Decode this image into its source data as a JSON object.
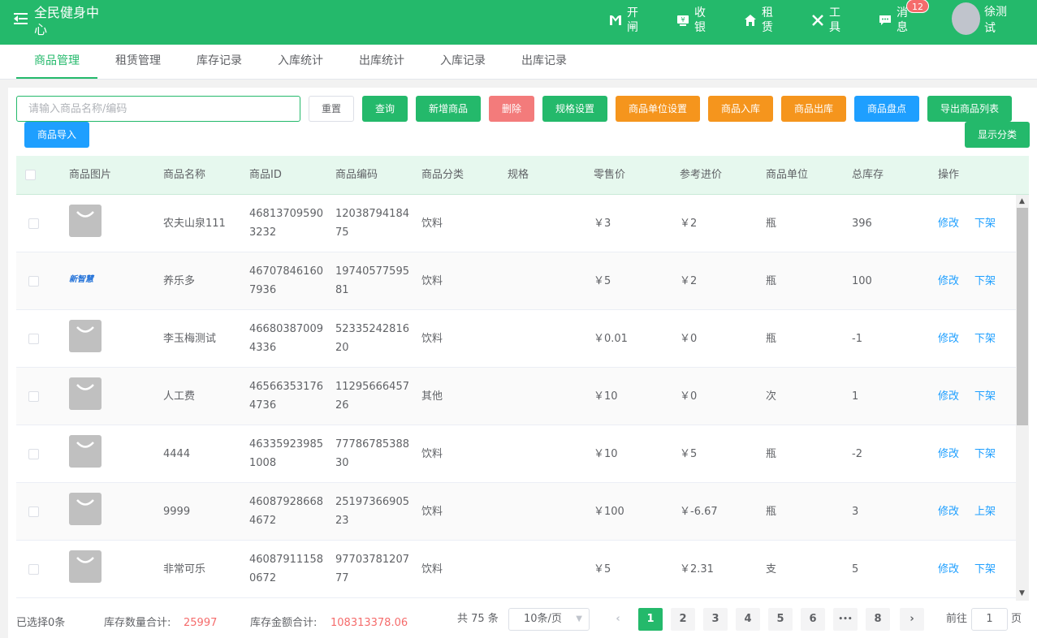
{
  "header": {
    "title": "全民健身中心",
    "nav": [
      {
        "label": "开闸",
        "icon": "gate-icon"
      },
      {
        "label": "收银",
        "icon": "cashier-icon"
      },
      {
        "label": "租赁",
        "icon": "rent-icon"
      },
      {
        "label": "工具",
        "icon": "tools-icon"
      },
      {
        "label": "消息",
        "icon": "message-icon"
      }
    ],
    "message_badge": "12",
    "user_name": "徐测试"
  },
  "tabs": [
    "商品管理",
    "租赁管理",
    "库存记录",
    "入库统计",
    "出库统计",
    "入库记录",
    "出库记录"
  ],
  "toolbar": {
    "search_placeholder": "请输入商品名称/编码",
    "reset": "重置",
    "query": "查询",
    "add": "新增商品",
    "delete": "删除",
    "spec": "规格设置",
    "unit": "商品单位设置",
    "stock_in": "商品入库",
    "stock_out": "商品出库",
    "inventory": "商品盘点",
    "export": "导出商品列表",
    "import": "商品导入",
    "show_category": "显示分类"
  },
  "table": {
    "headers": [
      "商品图片",
      "商品名称",
      "商品ID",
      "商品编码",
      "商品分类",
      "规格",
      "零售价",
      "参考进价",
      "商品单位",
      "总库存",
      "操作"
    ],
    "rows": [
      {
        "name": "农夫山泉111",
        "id": "468137095903232",
        "code": "1203879418475",
        "category": "饮料",
        "spec": "",
        "price": "￥3",
        "cost": "￥2",
        "unit": "瓶",
        "stock": "396",
        "edit": "修改",
        "shelf": "下架",
        "image": "bag"
      },
      {
        "name": "养乐多",
        "id": "467078461607936",
        "code": "1974057759581",
        "category": "饮料",
        "spec": "",
        "price": "￥5",
        "cost": "￥2",
        "unit": "瓶",
        "stock": "100",
        "edit": "修改",
        "shelf": "下架",
        "image": "logo",
        "logo_text": "新智慧"
      },
      {
        "name": "李玉梅测试",
        "id": "466803870094336",
        "code": "5233524281620",
        "category": "饮料",
        "spec": "",
        "price": "￥0.01",
        "cost": "￥0",
        "unit": "瓶",
        "stock": "-1",
        "edit": "修改",
        "shelf": "下架",
        "image": "bag"
      },
      {
        "name": "人工费",
        "id": "465663531764736",
        "code": "1129566645726",
        "category": "其他",
        "spec": "",
        "price": "￥10",
        "cost": "￥0",
        "unit": "次",
        "stock": "1",
        "edit": "修改",
        "shelf": "下架",
        "image": "bag"
      },
      {
        "name": "4444",
        "id": "463359239851008",
        "code": "7778678538830",
        "category": "饮料",
        "spec": "",
        "price": "￥10",
        "cost": "￥5",
        "unit": "瓶",
        "stock": "-2",
        "edit": "修改",
        "shelf": "下架",
        "image": "bag"
      },
      {
        "name": "9999",
        "id": "460879286684672",
        "code": "2519736690523",
        "category": "饮料",
        "spec": "",
        "price": "￥100",
        "cost": "￥-6.67",
        "unit": "瓶",
        "stock": "3",
        "edit": "修改",
        "shelf": "上架",
        "image": "bag"
      },
      {
        "name": "非常可乐",
        "id": "460879111580672",
        "code": "9770378120777",
        "category": "饮料",
        "spec": "",
        "price": "￥5",
        "cost": "￥2.31",
        "unit": "支",
        "stock": "5",
        "edit": "修改",
        "shelf": "下架",
        "image": "bag"
      }
    ]
  },
  "footer": {
    "selected": "已选择0条",
    "stock_qty_label": "库存数量合计:",
    "stock_qty": "25997",
    "stock_amount_label": "库存金额合计:",
    "stock_amount": "108313378.06",
    "total": "共 75 条",
    "page_size": "10条/页",
    "pages": [
      "1",
      "2",
      "3",
      "4",
      "5",
      "6",
      "•••",
      "8"
    ],
    "goto_label": "前往",
    "goto_value": "1",
    "page_suffix": "页"
  },
  "colors": {
    "primary": "#24b96b",
    "danger": "#f37b7b",
    "warning": "#f5951d",
    "info": "#1e9fff"
  }
}
